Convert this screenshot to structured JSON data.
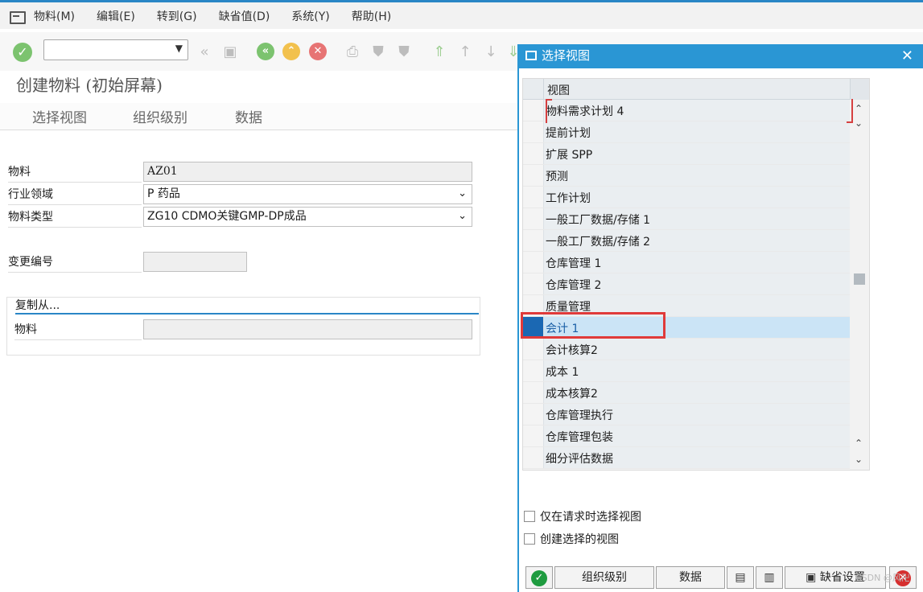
{
  "menu": {
    "items": [
      "物料(M)",
      "编辑(E)",
      "转到(G)",
      "缺省值(D)",
      "系统(Y)",
      "帮助(H)"
    ]
  },
  "screen": {
    "title": "创建物料 (初始屏幕)",
    "tabs": [
      "选择视图",
      "组织级别",
      "数据"
    ]
  },
  "form": {
    "material_label": "物料",
    "material_value": "AZ01",
    "industry_label": "行业领域",
    "industry_value": "P 药品",
    "type_label": "物料类型",
    "type_value": "ZG10 CDMO关键GMP-DP成品",
    "change_label": "变更编号",
    "change_value": "",
    "copy_from_title": "复制从...",
    "copy_material_label": "物料",
    "copy_material_value": ""
  },
  "dialog": {
    "title": "选择视图",
    "column_header": "视图",
    "rows": [
      "物料需求计划 4",
      "提前计划",
      "扩展 SPP",
      "预测",
      "工作计划",
      "一般工厂数据/存储 1",
      "一般工厂数据/存储 2",
      "仓库管理 1",
      "仓库管理 2",
      "质量管理",
      "会计 1",
      "会计核算2",
      "成本 1",
      "成本核算2",
      "仓库管理执行",
      "仓库管理包装",
      "细分评估数据"
    ],
    "selected_row": "会计 1",
    "checkbox_only_on_request": "仅在请求时选择视图",
    "checkbox_create_selected": "创建选择的视图",
    "btn_org_levels": "组织级别",
    "btn_data": "数据",
    "btn_default_settings": "缺省设置",
    "watermark": "CSDN @风卍"
  },
  "colors": {
    "accent": "#2a96d4",
    "selection": "#1b68b3",
    "highlight_border": "#e03a3a"
  }
}
